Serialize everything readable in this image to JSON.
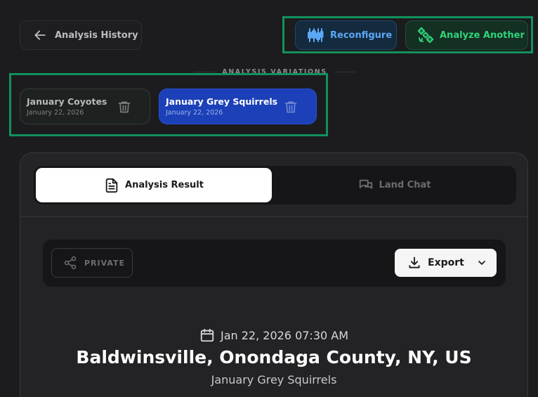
{
  "header": {
    "back_label": "Analysis History",
    "reconfigure_label": "Reconfigure",
    "analyze_another_label": "Analyze Another"
  },
  "variations": {
    "section_label": "ANALYSIS VARIATIONS",
    "items": [
      {
        "title": "January Coyotes",
        "date": "January 22, 2026",
        "selected": false
      },
      {
        "title": "January Grey Squirrels",
        "date": "January 22, 2026",
        "selected": true
      }
    ]
  },
  "tabs": [
    {
      "label": "Analysis Result",
      "icon": "document-icon",
      "active": true
    },
    {
      "label": "Land Chat",
      "icon": "chat-icon",
      "active": false
    }
  ],
  "toolbar": {
    "privacy_label": "PRIVATE",
    "export_label": "Export"
  },
  "report": {
    "datetime": "Jan 22, 2026 07:30 AM",
    "location": "Baldwinsville, Onondaga County, NY, US",
    "subtitle": "January Grey Squirrels"
  },
  "colors": {
    "background": "#1c1c1e",
    "accent_blue": "#5aa8f5",
    "accent_green": "#2ed47a",
    "selected_variation": "#1c40b8",
    "highlight_border": "#12915d"
  }
}
